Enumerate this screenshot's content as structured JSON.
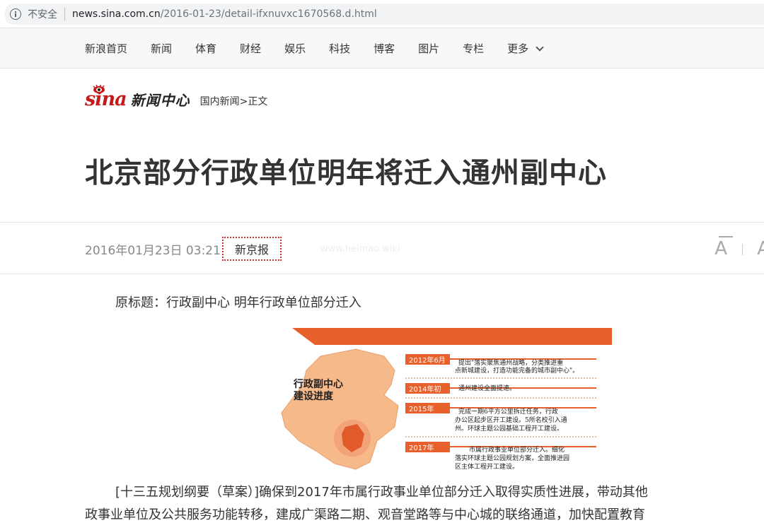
{
  "browser": {
    "security_label": "不安全",
    "url_host": "news.sina.com.cn",
    "url_path": "/2016-01-23/detail-ifxnuvxc1670568.d.html"
  },
  "nav": {
    "items": [
      "新浪首页",
      "新闻",
      "体育",
      "财经",
      "娱乐",
      "科技",
      "博客",
      "图片",
      "专栏",
      "更多"
    ]
  },
  "header": {
    "logo_text": "sina",
    "section_name": "新闻中心",
    "breadcrumb_link": "国内新闻",
    "breadcrumb_sep": ">",
    "breadcrumb_current": "正文"
  },
  "article": {
    "title": "北京部分行政单位明年将迁入通州副中心",
    "date": "2016年01月23日 03:21",
    "source": "新京报",
    "watermark": "www.heimao.wiki",
    "original_title": "原标题：行政副中心 明年行政单位部分迁入",
    "para_line1": "[十三五规划纲要（草案）]确保到2017年市属行政事业单位部分迁入取得实质性进展，带动其他",
    "para_line2": "政事业单位及公共服务功能转移，建成广渠路二期、观音堂路等与中心城的联络通道，加快配置教育"
  },
  "infographic": {
    "map_title_line1": "行政副中心",
    "map_title_line2": "建设进度",
    "events": [
      {
        "year": "2012年6月",
        "line1": "提出\"落实聚焦通州战略，分类推进重",
        "line2": "点新城建设，打造功能完备的城市副中心\"。"
      },
      {
        "year": "2014年初",
        "line1": "通州建设全面提速。",
        "line2": ""
      },
      {
        "year": "2015年",
        "line1": "完成一期6平方公里拆迁任务，行政",
        "line2": "办公区起步区开工建设。5所名校引入通",
        "line3": "州。环球主题公园基础工程开工建设。"
      },
      {
        "year": "2017年",
        "line1": "市属行政事业单位部分迁入。细化",
        "line2": "落实环球主题公园规划方案，全面推进园",
        "line3": "区主体工程开工建设。"
      }
    ],
    "colors": {
      "orange": "#e8602c",
      "map": "#f6b98a",
      "map_dark": "#e05a2a",
      "dotted": "#c97a4a"
    }
  },
  "controls": {
    "font_icon": "A"
  }
}
